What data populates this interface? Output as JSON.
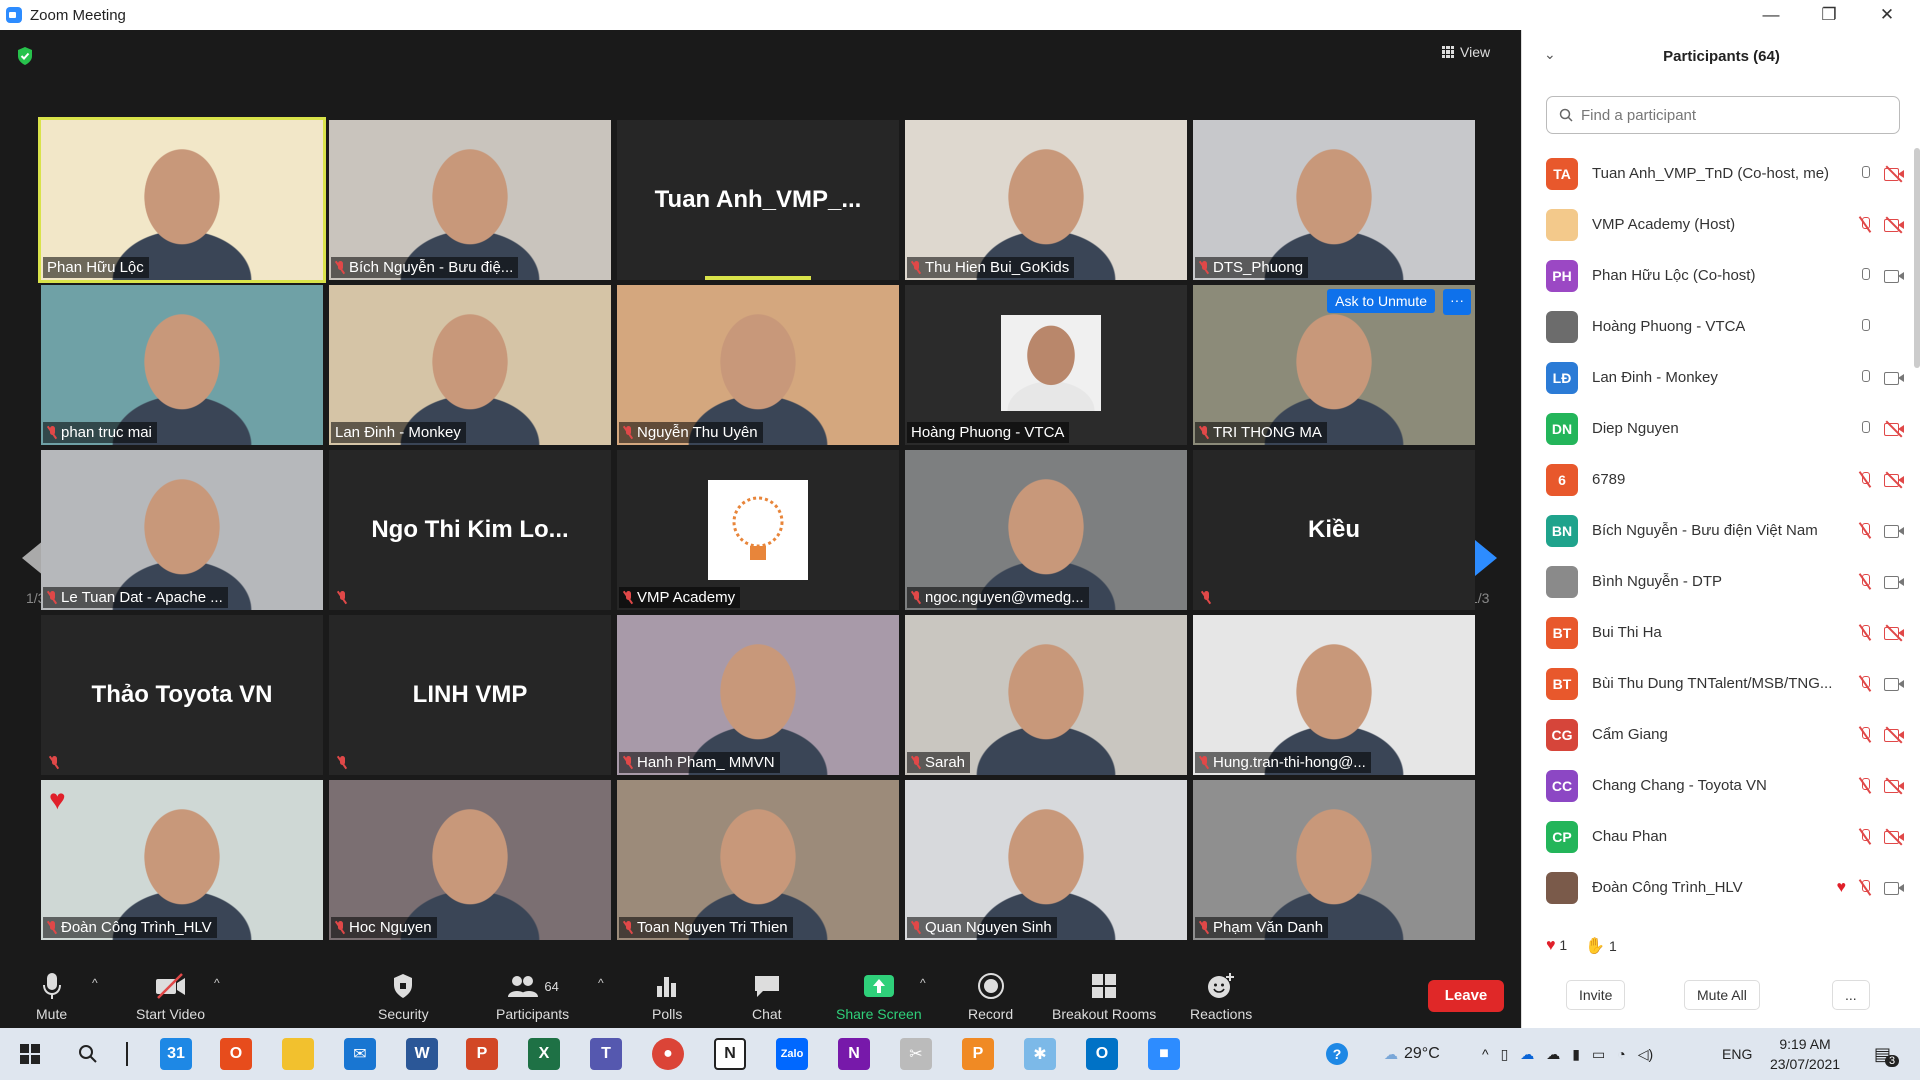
{
  "window": {
    "title": "Zoom Meeting"
  },
  "stage": {
    "view_label": "View",
    "page_indicator_left": "1/3",
    "page_indicator_right": "1/3",
    "tiles": [
      {
        "name": "Phan Hữu Lộc",
        "kind": "video",
        "muted": false,
        "bg": "#f2e7c8"
      },
      {
        "name": "Bích Nguyễn - Bưu điệ...",
        "kind": "video",
        "muted": true,
        "bg": "#c9c4bd"
      },
      {
        "name": "Tuan Anh_VMP_...",
        "kind": "text",
        "muted": false,
        "bg": "#262626"
      },
      {
        "name": "Thu Hien Bui_GoKids",
        "kind": "video",
        "muted": true,
        "bg": "#ded8cf"
      },
      {
        "name": "DTS_Phuong",
        "kind": "video",
        "muted": true,
        "bg": "#c7c8cb"
      },
      {
        "name": "phan truc mai",
        "kind": "video",
        "muted": true,
        "bg": "#6fa1a6"
      },
      {
        "name": "Lan Đinh - Monkey",
        "kind": "video",
        "muted": false,
        "bg": "#d5c4a6"
      },
      {
        "name": "Nguyễn Thu Uyên",
        "kind": "video",
        "muted": true,
        "bg": "#d4a77e"
      },
      {
        "name": "Hoàng Phuong - VTCA",
        "kind": "photo",
        "muted": false,
        "bg": "#2b2b2b"
      },
      {
        "name": "TRI THONG MA",
        "kind": "video",
        "muted": true,
        "bg": "#8c8b79"
      },
      {
        "name": "Le Tuan Dat - Apache ...",
        "kind": "video",
        "muted": true,
        "bg": "#b6b8bb"
      },
      {
        "name": "Ngo Thi Kim Lo...",
        "kind": "text",
        "muted": true,
        "bg": "#262626"
      },
      {
        "name": "VMP Academy",
        "kind": "logo",
        "muted": true,
        "bg": "#262626"
      },
      {
        "name": "ngoc.nguyen@vmedg...",
        "kind": "video",
        "muted": true,
        "bg": "#7d7f80"
      },
      {
        "name": "Kiều",
        "kind": "text",
        "muted": true,
        "bg": "#262626"
      },
      {
        "name": "Thảo Toyota VN",
        "kind": "text",
        "muted": true,
        "bg": "#262626"
      },
      {
        "name": "LINH VMP",
        "kind": "text",
        "muted": true,
        "bg": "#262626"
      },
      {
        "name": "Hanh Pham_ MMVN",
        "kind": "video",
        "muted": true,
        "bg": "#a89aa9"
      },
      {
        "name": "Sarah",
        "kind": "video",
        "muted": true,
        "bg": "#c9c6c0"
      },
      {
        "name": "Hung.tran-thi-hong@...",
        "kind": "video",
        "muted": true,
        "bg": "#e6e6e6"
      },
      {
        "name": "Đoàn Công Trình_HLV",
        "kind": "video",
        "muted": true,
        "bg": "#cfd8d5"
      },
      {
        "name": "Hoc Nguyen",
        "kind": "video",
        "muted": true,
        "bg": "#7b6f72"
      },
      {
        "name": "Toan Nguyen Tri Thien",
        "kind": "video",
        "muted": true,
        "bg": "#9c8b7a"
      },
      {
        "name": "Quan Nguyen Sinh",
        "kind": "video",
        "muted": true,
        "bg": "#d7d9dc"
      },
      {
        "name": "Phạm Văn Danh",
        "kind": "video",
        "muted": true,
        "bg": "#8f8f8f"
      }
    ],
    "ask_to_unmute": "Ask to Unmute",
    "more_label": "···"
  },
  "toolbar": {
    "mute": "Mute",
    "start_video": "Start Video",
    "security": "Security",
    "participants": "Participants",
    "participants_count": "64",
    "polls": "Polls",
    "chat": "Chat",
    "share_screen": "Share Screen",
    "record": "Record",
    "breakout_rooms": "Breakout Rooms",
    "reactions": "Reactions",
    "leave": "Leave"
  },
  "panel": {
    "title": "Participants (64)",
    "search_placeholder": "Find a participant",
    "participants": [
      {
        "initials": "TA",
        "name": "Tuan Anh_VMP_TnD (Co-host, me)",
        "color": "#e8582c",
        "mic": "on",
        "cam": "off",
        "heart": false
      },
      {
        "initials": "",
        "name": "VMP Academy (Host)",
        "color": "#f3c98b",
        "mic": "off",
        "cam": "off",
        "heart": false
      },
      {
        "initials": "PH",
        "name": "Phan Hữu Lộc (Co-host)",
        "color": "#9b48c4",
        "mic": "on",
        "cam": "on",
        "heart": false
      },
      {
        "initials": "",
        "name": "Hoàng Phuong - VTCA",
        "color": "#6c6c6c",
        "mic": "on",
        "cam": "none",
        "heart": false
      },
      {
        "initials": "LĐ",
        "name": "Lan Đinh - Monkey",
        "color": "#2b7bd6",
        "mic": "on",
        "cam": "on",
        "heart": false
      },
      {
        "initials": "DN",
        "name": "Diep Nguyen",
        "color": "#23b55a",
        "mic": "on",
        "cam": "off",
        "heart": false
      },
      {
        "initials": "6",
        "name": "6789",
        "color": "#e8582c",
        "mic": "off",
        "cam": "off",
        "heart": false
      },
      {
        "initials": "BN",
        "name": "Bích Nguyễn - Bưu điện Việt Nam",
        "color": "#1fa38c",
        "mic": "off",
        "cam": "on",
        "heart": false
      },
      {
        "initials": "",
        "name": "Bình Nguyễn - DTP",
        "color": "#8a8a8a",
        "mic": "off",
        "cam": "on",
        "heart": false
      },
      {
        "initials": "BT",
        "name": "Bui Thi Ha",
        "color": "#e8582c",
        "mic": "off",
        "cam": "off",
        "heart": false
      },
      {
        "initials": "BT",
        "name": "Bùi Thu Dung TNTalent/MSB/TNG...",
        "color": "#e8582c",
        "mic": "off",
        "cam": "on",
        "heart": false
      },
      {
        "initials": "CG",
        "name": "Cẩm Giang",
        "color": "#d6453a",
        "mic": "off",
        "cam": "off",
        "heart": false
      },
      {
        "initials": "CC",
        "name": "Chang Chang - Toyota VN",
        "color": "#8c47c4",
        "mic": "off",
        "cam": "off",
        "heart": false
      },
      {
        "initials": "CP",
        "name": "Chau Phan",
        "color": "#23b55a",
        "mic": "off",
        "cam": "off",
        "heart": false
      },
      {
        "initials": "",
        "name": "Đoàn Công Trình_HLV",
        "color": "#7a5a4a",
        "mic": "off",
        "cam": "on",
        "heart": true
      }
    ],
    "reaction_heart_count": "1",
    "reaction_clap_count": "1",
    "invite": "Invite",
    "mute_all": "Mute All",
    "more": "..."
  },
  "taskbar": {
    "temperature": "29°C",
    "language": "ENG",
    "time": "9:19 AM",
    "date": "23/07/2021",
    "notifications": "3"
  }
}
